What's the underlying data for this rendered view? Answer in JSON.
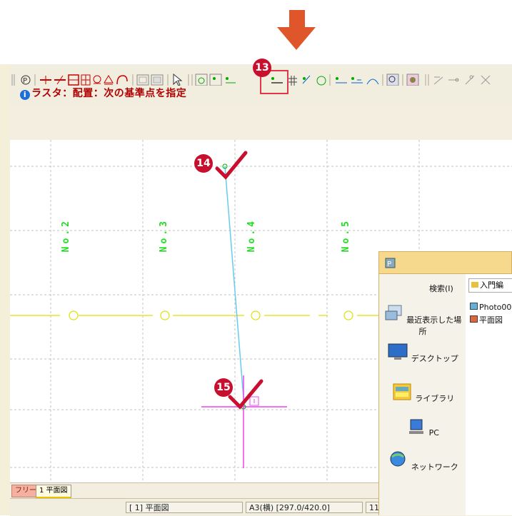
{
  "toolbar": {
    "icons": [
      "cursor-icon",
      "line-icon",
      "snap-icon",
      "rect-icon",
      "grid-icon",
      "pin-icon",
      "pin2-icon",
      "curve-icon",
      "box-icon",
      "box2-icon",
      "pointer-icon",
      "point-snap-icon",
      "point-icon",
      "base-line-icon",
      "grid-snap-icon",
      "vertex-icon",
      "circle-snap-icon",
      "offset-icon",
      "measure-icon",
      "tangent-icon",
      "zoom-icon",
      "layer-icon",
      "edit1-icon",
      "edit2-icon",
      "edit3-icon",
      "edit4-icon"
    ]
  },
  "command_status": "ラスタ：配置：次の基準点を指定",
  "callouts": {
    "c13": "13",
    "c14": "14",
    "c15": "15"
  },
  "canvas": {
    "labels": [
      "No.2",
      "No.3",
      "No.4",
      "No.5"
    ],
    "colors": {
      "grid": "#c0c0c0",
      "stations": "#22dd22",
      "road": "#e0e000",
      "track": "#66ccee",
      "cross": "#ee44ee"
    }
  },
  "tabs": {
    "free": "フリー",
    "plan": "1 平面図"
  },
  "statusbar": {
    "layer": "[ 1] 平面図",
    "paper": "A3(横) [297.0/420.0]",
    "extra": "11"
  },
  "dialog": {
    "search_label": "検索(I)",
    "search_value": "入門編",
    "places": [
      "最近表示した場所",
      "デスクトップ",
      "ライブラリ",
      "PC",
      "ネットワーク"
    ],
    "files": [
      "Photo00",
      "平面図"
    ]
  },
  "accent": "#e0562b"
}
